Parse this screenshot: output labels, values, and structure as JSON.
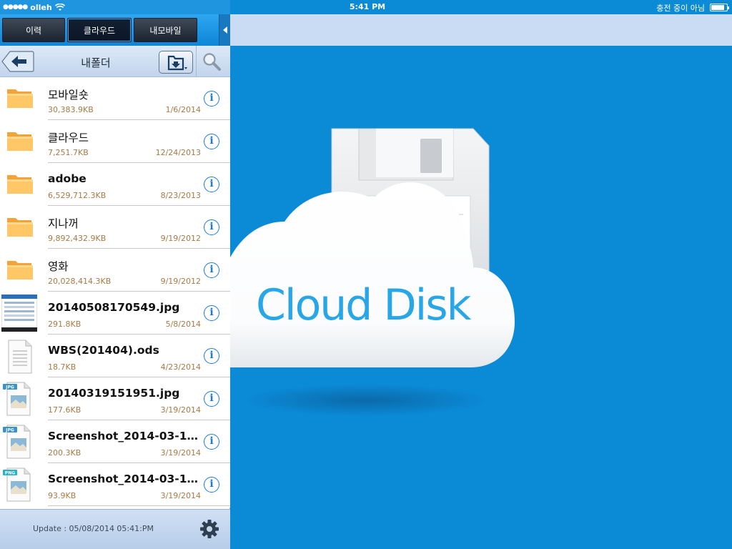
{
  "status_bar": {
    "signal_dots": "●●●●●",
    "carrier": "olleh",
    "time": "5:41 PM",
    "charging_text": "충전 중이 아님",
    "battery_level": 0.85
  },
  "tabs": [
    {
      "label": "이력"
    },
    {
      "label": "클라우드"
    },
    {
      "label": "내모바일"
    }
  ],
  "active_tab": "클라우드",
  "nav": {
    "title": "내폴더"
  },
  "files": [
    {
      "name": "모바일숏",
      "size": "30,383.9KB",
      "date": "1/6/2014",
      "type": "folder"
    },
    {
      "name": "클라우드",
      "size": "7,251.7KB",
      "date": "12/24/2013",
      "type": "folder"
    },
    {
      "name": "adobe",
      "size": "6,529,712.3KB",
      "date": "8/23/2013",
      "type": "folder"
    },
    {
      "name": "지나꺼",
      "size": "9,892,432.9KB",
      "date": "9/19/2012",
      "type": "folder"
    },
    {
      "name": "영화",
      "size": "20,028,414.3KB",
      "date": "9/19/2012",
      "type": "folder"
    },
    {
      "name": "20140508170549.jpg",
      "size": "291.8KB",
      "date": "5/8/2014",
      "type": "photo"
    },
    {
      "name": "WBS(201404).ods",
      "size": "18.7KB",
      "date": "4/23/2014",
      "type": "document"
    },
    {
      "name": "20140319151951.jpg",
      "size": "177.6KB",
      "date": "3/19/2014",
      "type": "jpg"
    },
    {
      "name": "Screenshot_2014-03-19-...",
      "size": "200.3KB",
      "date": "3/19/2014",
      "type": "jpg"
    },
    {
      "name": "Screenshot_2014-03-19-...",
      "size": "93.9KB",
      "date": "3/19/2014",
      "type": "png"
    }
  ],
  "file_badges": {
    "jpg": "JPG",
    "png": "PNG"
  },
  "info_glyph": "i",
  "footer": {
    "update_text": "Update : 05/08/2014 05:41:PM"
  },
  "brand": {
    "app_logo_text": "Cloud Disk"
  },
  "colors": {
    "accent_blue": "#0b8ad6",
    "info_blue": "#1a7ae2",
    "meta_brown": "#a77a44",
    "logo_blue": "#28a6e6"
  },
  "icons": [
    "back-arrow-icon",
    "folder-download-icon",
    "search-icon",
    "info-icon",
    "gear-icon",
    "folder-icon",
    "document-icon",
    "image-file-icon",
    "collapse-arrow-icon",
    "wifi-icon",
    "battery-icon",
    "floppy-disk-icon",
    "cloud-icon"
  ]
}
